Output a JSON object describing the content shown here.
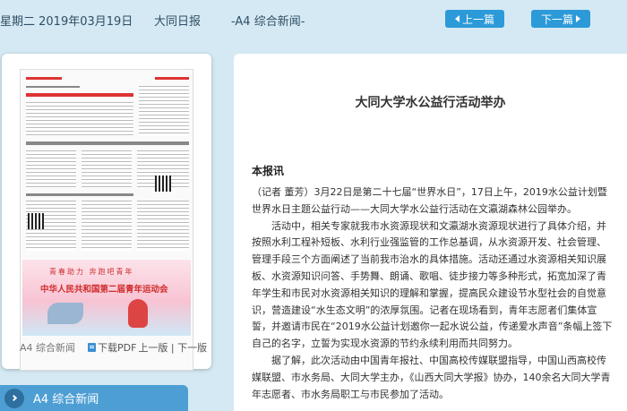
{
  "header": {
    "date": "星期二 2019年03月19日",
    "paper_name": "大同日报",
    "section": "-A4 综合新闻-",
    "prev_label": "上一篇",
    "next_label": "下一篇"
  },
  "page_card": {
    "caption": "A4 综合新闻",
    "pdf_label": "下载PDF",
    "pager": "上一版 | 下一版",
    "thumb_slogan": "青春助力 奔跑吧青年",
    "thumb_title": "中华人民共和国第二届青年运动会"
  },
  "section_bar": {
    "label": "A4 综合新闻"
  },
  "article": {
    "title": "大同大学水公益行活动举办",
    "byline": "本报讯",
    "paragraphs": [
      "（记者 董芳）3月22日是第二十七届“世界水日”，17日上午，2019水公益计划暨世界水日主题公益行动——大同大学水公益行活动在文瀛湖森林公园举办。",
      "活动中，相关专家就我市水资源现状和文瀛湖水资源现状进行了具体介绍，并按照水利工程补短板、水利行业强监管的工作总基调，从水资源开发、社会管理、管理手段三个方面阐述了当前我市治水的具体措施。活动还通过水资源相关知识展板、水资源知识问答、手势舞、朗诵、歌唱、徒步接力等多种形式，拓宽加深了青年学生和市民对水资源相关知识的理解和掌握，提高民众建设节水型社会的自觉意识，营造建设“水生态文明”的浓厚氛围。记者在现场看到，青年志愿者们集体宣誓，并邀请市民在“2019水公益计划邀你一起水说公益，传递爱水声音”条幅上签下自己的名字，立誓为实现水资源的节约永续利用而共同努力。",
      "据了解，此次活动由中国青年报社、中国高校传媒联盟指导，中国山西高校传媒联盟、市水务局、大同大学主办，《山西大同大学报》协办，140余名大同大学青年志愿者、市水务局职工与市民参加了活动。"
    ]
  }
}
